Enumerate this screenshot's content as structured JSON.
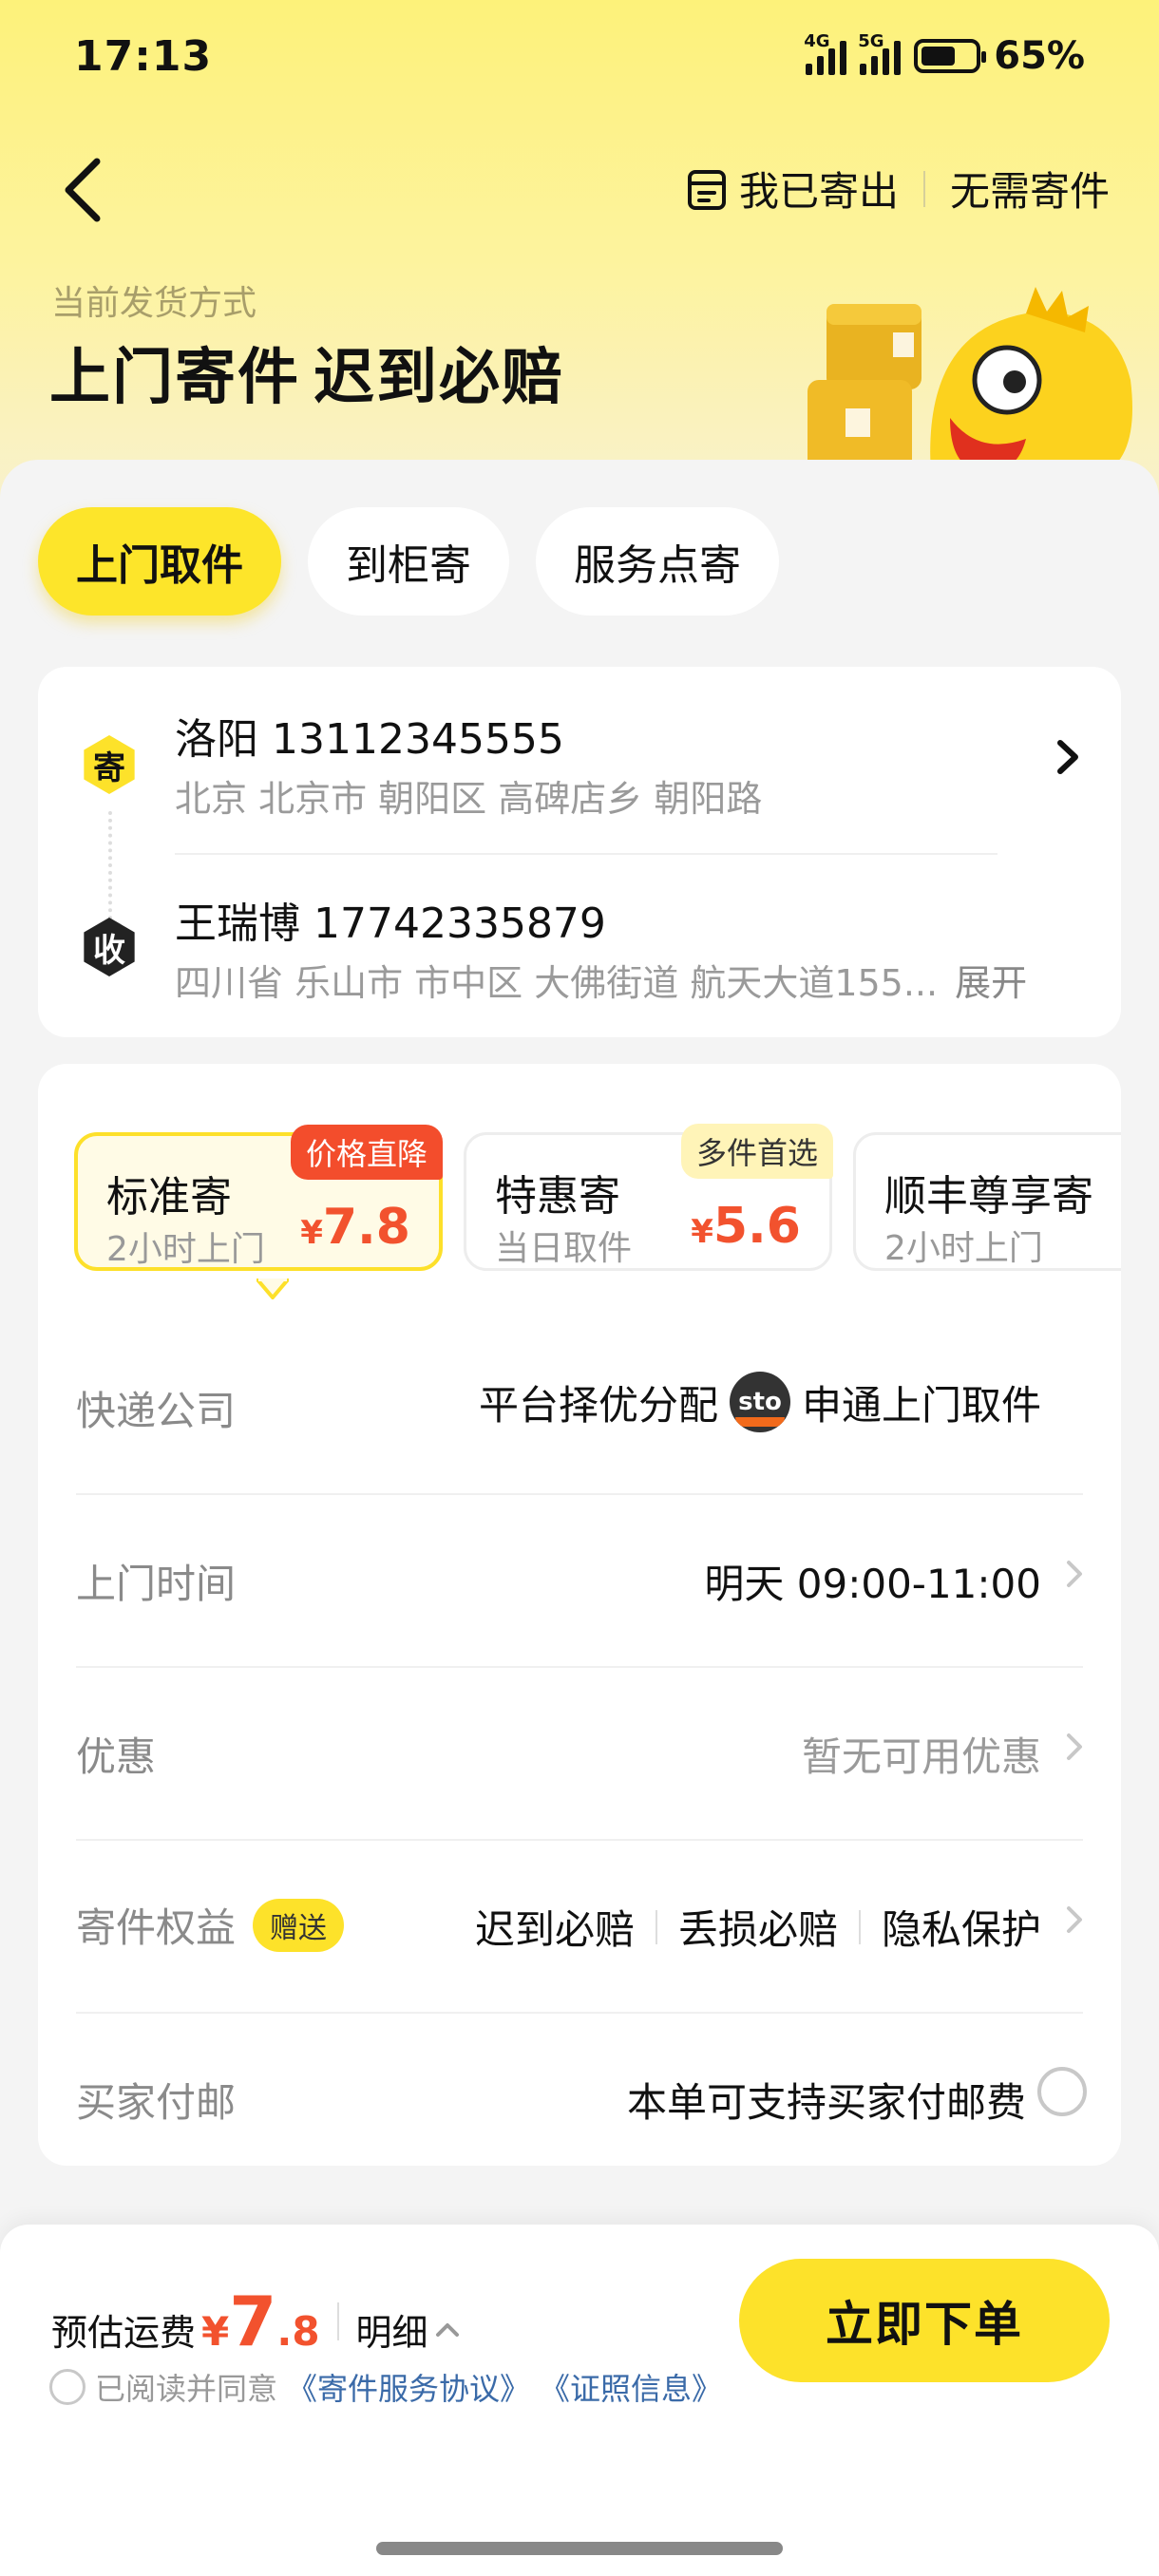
{
  "status": {
    "time": "17:13",
    "net1": "4G",
    "net2": "5G",
    "battery": "65%",
    "battery_level": 0.65
  },
  "header": {
    "sent_label": "我已寄出",
    "no_need_label": "无需寄件",
    "method_caption": "当前发货方式",
    "method_title_main": "上门寄件",
    "method_title_highlight": "迟到必赔"
  },
  "tabs": [
    {
      "label": "上门取件",
      "active": true
    },
    {
      "label": "到柜寄",
      "active": false
    },
    {
      "label": "服务点寄",
      "active": false
    }
  ],
  "sender": {
    "badge": "寄",
    "name": "洛阳 13112345555",
    "address": "北京 北京市 朝阳区 高碑店乡 朝阳路"
  },
  "receiver": {
    "badge": "收",
    "name": "王瑞博 17742335879",
    "address": "四川省 乐山市 市中区 大佛街道 航天大道155...",
    "expand_label": "展开"
  },
  "services": [
    {
      "name": "标准寄",
      "sub": "2小时上门",
      "price_symbol": "¥",
      "price": "7.8",
      "tag": "价格直降",
      "active": true
    },
    {
      "name": "特惠寄",
      "sub": "当日取件",
      "price_symbol": "¥",
      "price": "5.6",
      "tag": "多件首选",
      "active": false
    },
    {
      "name": "顺丰尊享寄",
      "sub": "2小时上门",
      "price_symbol": "¥",
      "price": "",
      "tag": "",
      "active": false
    }
  ],
  "options": {
    "courier": {
      "label": "快递公司",
      "prefix": "平台择优分配",
      "logo_text": "sto",
      "value": "申通上门取件"
    },
    "pickup_time": {
      "label": "上门时间",
      "value": "明天 09:00-11:00"
    },
    "discount": {
      "label": "优惠",
      "value": "暂无可用优惠"
    },
    "rights": {
      "label": "寄件权益",
      "gift": "赠送",
      "items": [
        "迟到必赔",
        "丢损必赔",
        "隐私保护"
      ]
    },
    "buyer_pay": {
      "label": "买家付邮",
      "value": "本单可支持买家付邮费"
    }
  },
  "footer": {
    "fee_label": "预估运费",
    "fee_symbol": "¥",
    "fee_int": "7",
    "fee_dec": ".8",
    "detail_label": "明细",
    "agree_text": "已阅读并同意",
    "agreement_link": "《寄件服务协议》",
    "license_link": "《证照信息》",
    "order_button": "立即下单"
  },
  "colors": {
    "brand_yellow": "#fde22a",
    "price_red": "#f2522e",
    "link_blue": "#3a6aa8"
  }
}
